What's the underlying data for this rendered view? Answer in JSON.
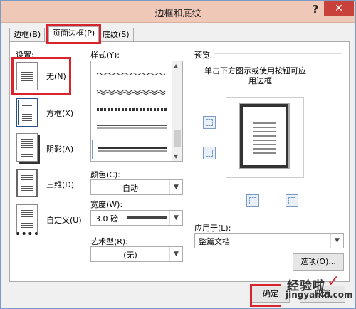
{
  "window": {
    "title": "边框和底纹",
    "help": "?",
    "close": "✕"
  },
  "tabs": [
    {
      "label": "边框(B)"
    },
    {
      "label": "页面边框(P)"
    },
    {
      "label": "底纹(S)"
    }
  ],
  "settings": {
    "heading": "设置:",
    "items": [
      {
        "label": "无(N)"
      },
      {
        "label": "方框(X)"
      },
      {
        "label": "阴影(A)"
      },
      {
        "label": "三维(D)"
      },
      {
        "label": "自定义(U)"
      }
    ]
  },
  "style": {
    "label": "样式(Y):"
  },
  "color": {
    "label": "颜色(C):",
    "value": "自动"
  },
  "width": {
    "label": "宽度(W):",
    "value": "3.0 磅"
  },
  "art": {
    "label": "艺术型(R):",
    "value": "(无)"
  },
  "preview": {
    "heading": "预览",
    "hint_line1": "单击下方图示或使用按钮可应",
    "hint_line2": "用边框"
  },
  "apply_to": {
    "label": "应用于(L):",
    "value": "整篇文档"
  },
  "buttons": {
    "options": "选项(O)...",
    "ok": "确定",
    "cancel": "取消"
  },
  "watermark": {
    "line1": "经验啦",
    "line2": "jingyanla.com",
    "check": "✓"
  },
  "colors": {
    "highlight": "#d8252d",
    "titlebar": "#f0c8b8",
    "close": "#c8413a"
  }
}
